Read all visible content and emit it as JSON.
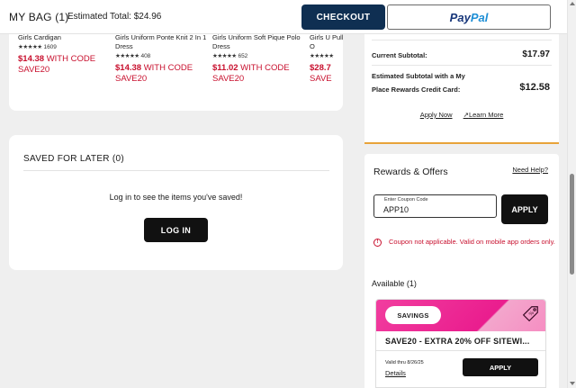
{
  "header": {
    "bag_title": "MY BAG (1)",
    "estimated_total": "Estimated Total: $24.96",
    "checkout_label": "CHECKOUT",
    "paypal_part1": "Pay",
    "paypal_part2": "Pal"
  },
  "products": [
    {
      "name": "Girls Cardigan",
      "stars": "★★★★★",
      "reviews": "1609",
      "price": "$14.38",
      "price_suffix": " WITH CODE",
      "code": "SAVE20"
    },
    {
      "name": "Girls Uniform Ponte Knit 2 In 1 Dress",
      "stars": "★★★★★",
      "reviews": "408",
      "price": "$14.38",
      "price_suffix": " WITH CODE",
      "code": "SAVE20"
    },
    {
      "name": "Girls Uniform Soft Pique Polo Dress",
      "stars": "★★★★★",
      "reviews": "652",
      "price": "$11.02",
      "price_suffix": " WITH CODE",
      "code": "SAVE20"
    },
    {
      "name": "Girls U Pull O",
      "stars": "★★★★★",
      "reviews": "",
      "price": "$28.7",
      "price_suffix": "",
      "code": "SAVE"
    }
  ],
  "saved": {
    "title": "SAVED FOR LATER (0)",
    "message": "Log in to see the items you've saved!",
    "login_label": "LOG IN"
  },
  "summary": {
    "current_subtotal_label": "Current Subtotal:",
    "current_subtotal_value": "$17.97",
    "estimated_label_line1": "Estimated Subtotal with a My",
    "estimated_label_line2": "Place Rewards Credit Card:",
    "estimated_value": "$12.58",
    "apply_now": "Apply Now",
    "learn_more": "Learn More"
  },
  "rewards": {
    "title": "Rewards & Offers",
    "help": "Need Help?",
    "coupon_label": "Enter Coupon Code",
    "coupon_value": "APP10",
    "apply_label": "APPLY",
    "error": "Coupon not applicable. Valid on mobile app orders only.",
    "available": "Available (1)",
    "offer": {
      "badge": "SAVINGS",
      "name": "SAVE20 - EXTRA 20% OFF SITEWI...",
      "valid": "Valid thru 8/26/25",
      "details": "Details",
      "apply_label": "APPLY"
    }
  },
  "colors": {
    "brand_navy": "#0f2f52",
    "sale_red": "#c8102e",
    "offer_pink": "#ea1d8e",
    "accent_orange": "#e8a33a"
  }
}
